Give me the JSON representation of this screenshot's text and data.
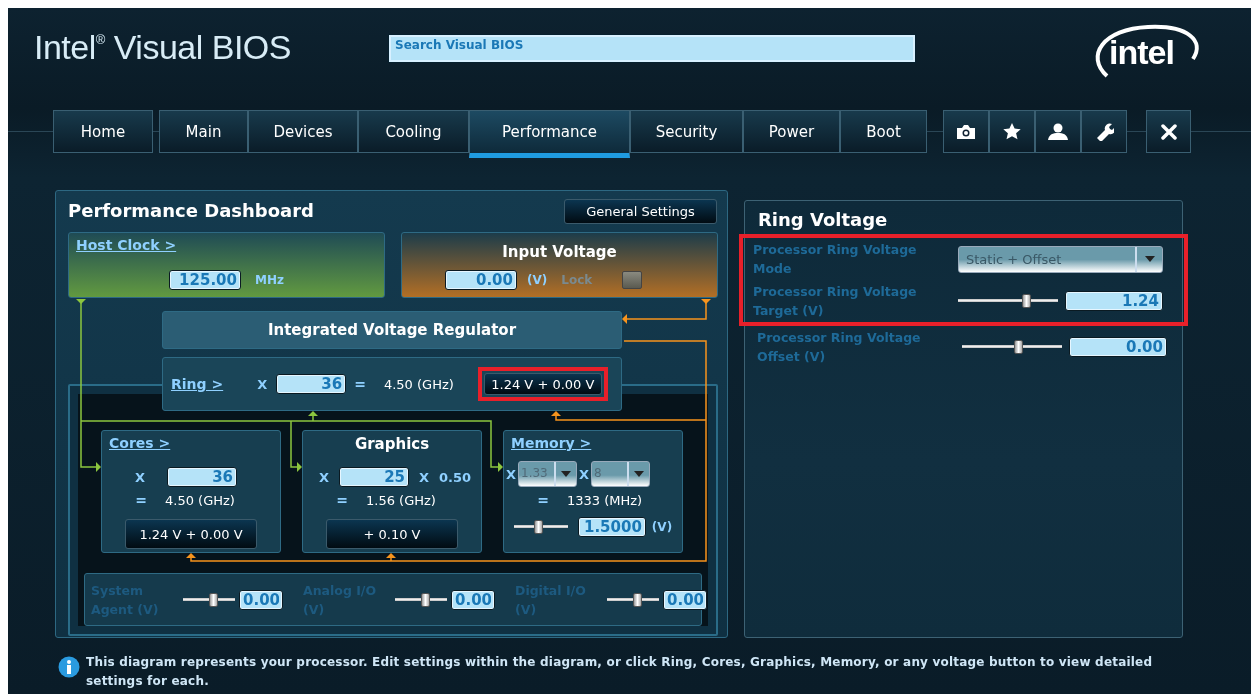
{
  "header": {
    "title": "Intel$^{®}$ Visual BIOS",
    "search": {
      "placeholder": "Search Visual BIOS"
    },
    "logo": "intel"
  },
  "nav": {
    "home": {
      "label": "Home",
      "selected": false
    },
    "tabs": [
      {
        "label": "Main",
        "selected": false
      },
      {
        "label": "Devices",
        "selected": false
      },
      {
        "label": "Cooling",
        "selected": false
      },
      {
        "label": "Performance",
        "selected": true
      },
      {
        "label": "Security",
        "selected": false
      },
      {
        "label": "Power",
        "selected": false
      },
      {
        "label": "Boot",
        "selected": false
      }
    ],
    "tools": [
      {
        "kind": "camera"
      },
      {
        "kind": "star"
      },
      {
        "kind": "user"
      },
      {
        "kind": "wrench"
      }
    ],
    "close": {
      "kind": "close"
    }
  },
  "dashboard": {
    "title": "Performance Dashboard",
    "general_settings": "General Settings",
    "host_clock": {
      "label": "Host Clock >",
      "value": "125.00",
      "unit": "MHz"
    },
    "input_voltage": {
      "title": "Input Voltage",
      "value": "0.00",
      "unit": "(V)",
      "lock_label": "Lock",
      "locked": false
    },
    "ivr": "Integrated Voltage Regulator",
    "ring": {
      "label": "Ring >",
      "x_label": "X",
      "multiplier": "36",
      "equals": "=",
      "frequency": "4.50 (GHz)",
      "voltage": "1.24 V + 0.00 V",
      "highlighted": true
    },
    "domains": [
      {
        "kind": "cores",
        "title": "Cores >",
        "link": true,
        "x_label": "X",
        "multiplier": "36",
        "equals": "=",
        "frequency": "4.50 (GHz)",
        "voltage": "1.24 V + 0.00 V"
      },
      {
        "kind": "graphics",
        "title": "Graphics",
        "link": false,
        "x_label": "X",
        "multiplier": "25",
        "ratio_label": "X",
        "ratio": "0.50",
        "equals": "=",
        "frequency": "1.56 (GHz)",
        "voltage": "+ 0.10 V"
      },
      {
        "kind": "memory",
        "title": "Memory >",
        "link": true,
        "x_label": "X",
        "ratio": "1.33",
        "x_label_2": "X",
        "multiplier": "8",
        "equals": "=",
        "frequency": "1333 (MHz)",
        "level": 0.45,
        "voltage": "1.5000",
        "unit": "(V)"
      }
    ],
    "rails": [
      {
        "label": "System Agent (V)",
        "level": 0.6,
        "value": "0.00"
      },
      {
        "label": "Analog I/O (V)",
        "level": 0.6,
        "value": "0.00"
      },
      {
        "label": "Digital I/O (V)",
        "level": 0.6,
        "value": "0.00"
      }
    ]
  },
  "ring_voltage": {
    "title": "Ring Voltage",
    "settings": [
      {
        "kind": "dropdown",
        "label": "Processor Ring Voltage Mode",
        "value": "Static + Offset",
        "highlighted": true
      },
      {
        "kind": "slider",
        "label": "Processor Ring Voltage Target (V)",
        "level": 0.7,
        "value": "1.24",
        "highlighted": true
      },
      {
        "kind": "slider",
        "label": "Processor Ring Voltage Offset (V)",
        "level": 0.57,
        "value": "0.00",
        "highlighted": false
      }
    ]
  },
  "info": "This diagram represents your processor. Edit settings within the diagram, or click Ring, Cores, Graphics, Memory, or any voltage button to view detailed settings for each."
}
